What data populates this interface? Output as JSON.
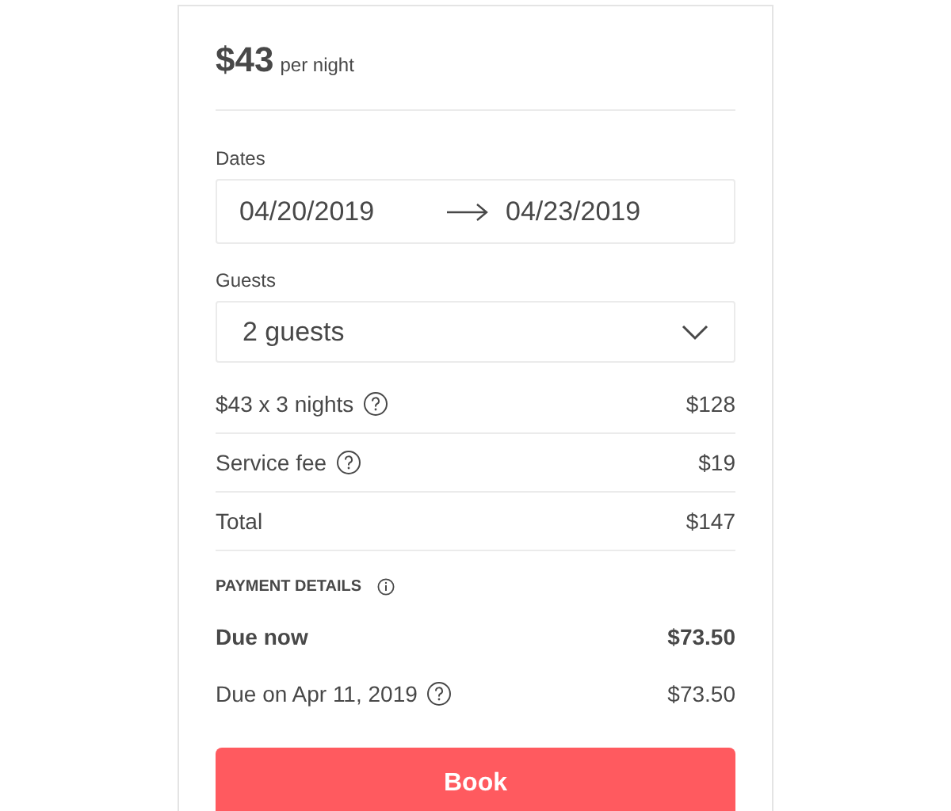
{
  "price": {
    "amount": "$43",
    "unit": "per night"
  },
  "dates": {
    "label": "Dates",
    "check_in": "04/20/2019",
    "check_out": "04/23/2019"
  },
  "guests": {
    "label": "Guests",
    "value": "2 guests"
  },
  "charges": [
    {
      "label": "$43 x 3 nights",
      "amount": "$128",
      "help": true
    },
    {
      "label": "Service fee",
      "amount": "$19",
      "help": true
    },
    {
      "label": "Total",
      "amount": "$147",
      "help": false
    }
  ],
  "payment": {
    "title": "PAYMENT DETAILS",
    "rows": [
      {
        "label": "Due now",
        "amount": "$73.50",
        "help": false,
        "emphasized": true
      },
      {
        "label": "Due on Apr 11, 2019",
        "amount": "$73.50",
        "help": true,
        "emphasized": false
      }
    ]
  },
  "book_button": "Book"
}
